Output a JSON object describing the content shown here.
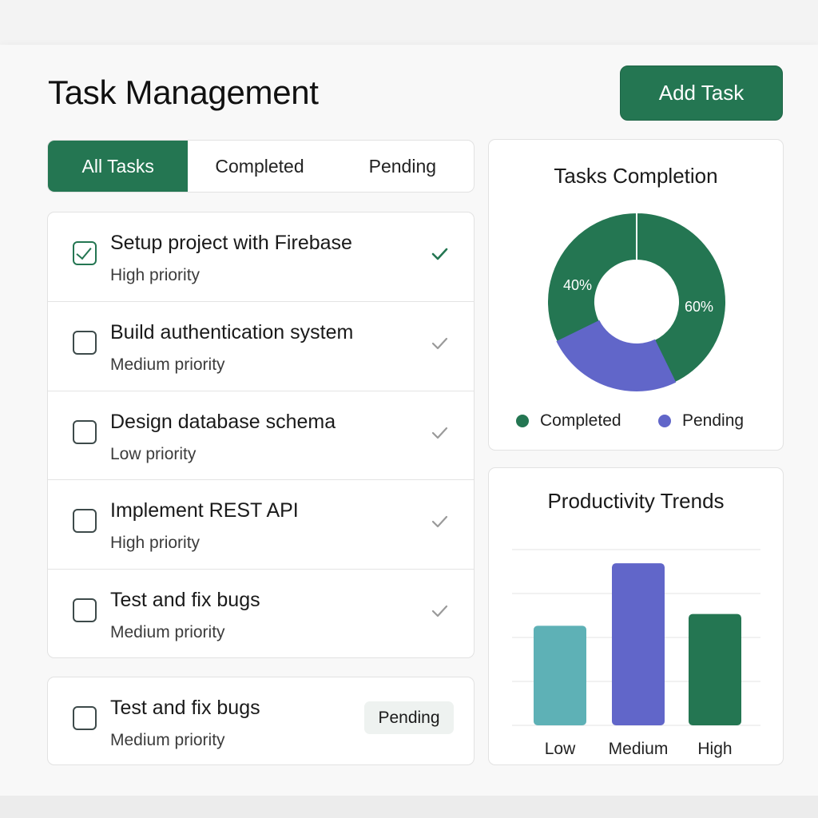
{
  "header": {
    "title": "Task Management",
    "add_task_label": "Add Task"
  },
  "tabs": [
    {
      "label": "All Tasks",
      "active": true
    },
    {
      "label": "Completed",
      "active": false
    },
    {
      "label": "Pending",
      "active": false
    }
  ],
  "tasks": [
    {
      "title": "Setup project with Firebase",
      "priority": "High priority",
      "checked": true
    },
    {
      "title": "Build authentication system",
      "priority": "Medium priority",
      "checked": false
    },
    {
      "title": "Design database schema",
      "priority": "Low priority",
      "checked": false
    },
    {
      "title": "Implement REST API",
      "priority": "High priority",
      "checked": false
    },
    {
      "title": "Test and fix bugs",
      "priority": "Medium priority",
      "checked": false
    }
  ],
  "pending_card": {
    "title": "Test and fix bugs",
    "priority": "Medium priority",
    "status": "Pending"
  },
  "icons": {
    "row_check": "check-icon",
    "checkbox_tick": "checkmark-icon"
  },
  "colors": {
    "accent": "#247652",
    "completed": "#247652",
    "pending": "#6166C9",
    "bar_low": "#5EB1B6",
    "bar_medium": "#6166C9",
    "bar_high": "#247652",
    "check_active": "#247652",
    "check_inactive": "#9a9a9a"
  },
  "chart_data": [
    {
      "type": "pie",
      "title": "Tasks Completion",
      "slices": [
        {
          "name": "Completed",
          "value": 60,
          "label": "60%"
        },
        {
          "name": "Completed",
          "value": 40,
          "label": "40%"
        }
      ],
      "pending_overlay_value": 25,
      "legend": [
        {
          "name": "Completed",
          "color": "#247652"
        },
        {
          "name": "Pending",
          "color": "#6166C9"
        }
      ],
      "legend_position": "bottom"
    },
    {
      "type": "bar",
      "title": "Productivity Trends",
      "categories": [
        "Low",
        "Medium",
        "High"
      ],
      "values": [
        51,
        83,
        57
      ],
      "ylim": [
        0,
        90
      ],
      "grid": true
    }
  ]
}
